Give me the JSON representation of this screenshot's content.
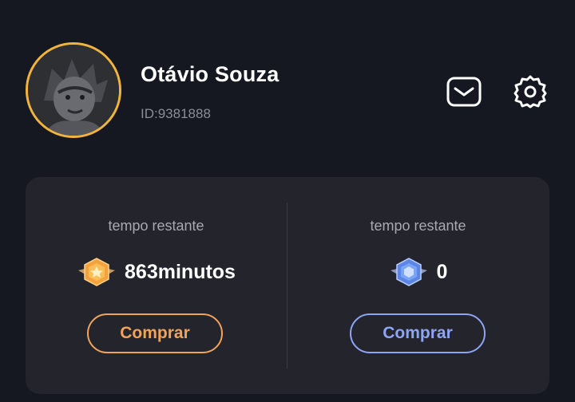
{
  "profile": {
    "name": "Otávio Souza",
    "id": "ID:9381888"
  },
  "header_icons": [
    "mail-icon",
    "gear-icon"
  ],
  "balance": {
    "left": {
      "label": "tempo restante",
      "value": "863minutos",
      "icon": "gold-coin-icon",
      "button_label": "Comprar",
      "accent": "#f2a35a"
    },
    "right": {
      "label": "tempo restante",
      "value": "0",
      "icon": "blue-gem-icon",
      "button_label": "Comprar",
      "accent": "#8ea5f5"
    }
  },
  "colors": {
    "background": "#151821",
    "card": "#23242c",
    "avatar_ring": "#f2b43c"
  }
}
